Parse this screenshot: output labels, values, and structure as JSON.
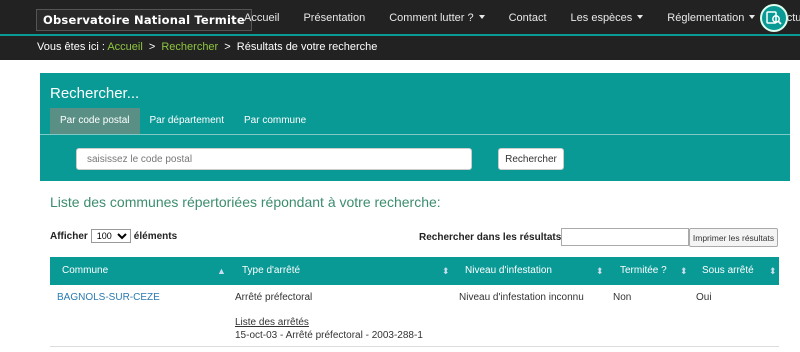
{
  "brand": {
    "name": "Observatoire National Termite"
  },
  "nav": {
    "items": [
      {
        "label": "Accueil",
        "dropdown": false
      },
      {
        "label": "Présentation",
        "dropdown": false
      },
      {
        "label": "Comment lutter ?",
        "dropdown": true
      },
      {
        "label": "Contact",
        "dropdown": false
      },
      {
        "label": "Les espèces",
        "dropdown": true
      },
      {
        "label": "Réglementation",
        "dropdown": true
      },
      {
        "label": "Actualités",
        "dropdown": false
      }
    ],
    "logo_icon": "search-book-icon"
  },
  "breadcrumb": {
    "prefix": "Vous êtes ici :",
    "items": [
      "Accueil",
      "Rechercher"
    ],
    "separator": ">",
    "current": "Résultats de votre recherche"
  },
  "search": {
    "title": "Rechercher...",
    "tabs": [
      "Par code postal",
      "Par département",
      "Par commune"
    ],
    "active_tab": 0,
    "placeholder": "saisissez le code postal",
    "value": "",
    "button": "Rechercher"
  },
  "results": {
    "heading": "Liste des communes répertoriées répondant à votre recherche:",
    "show_prefix": "Afficher",
    "show_value": "100",
    "show_suffix": "éléments",
    "search_label": "Rechercher dans les résultats :",
    "print_button": "Imprimer les résultats"
  },
  "table": {
    "columns": [
      "Commune",
      "Type d'arrêté",
      "Niveau d'infestation",
      "Termitée ?",
      "Sous arrêté"
    ],
    "rows": [
      {
        "commune": "BAGNOLS-SUR-CEZE",
        "type": "Arrêté préfectoral",
        "niveau": "Niveau d'infestation inconnu",
        "termitee": "Non",
        "sous_arrete": "Oui",
        "arretes_link": "Liste des arrêtés",
        "arretes_detail": "15-oct-03 - Arrêté préfectoral - 2003-288-1"
      }
    ]
  },
  "colors": {
    "navbar": "#222222",
    "accent": "#0a9a96",
    "crumb_link": "#8fc63f",
    "heading": "#3c8d6e",
    "commune_link": "#2a7ab0"
  }
}
